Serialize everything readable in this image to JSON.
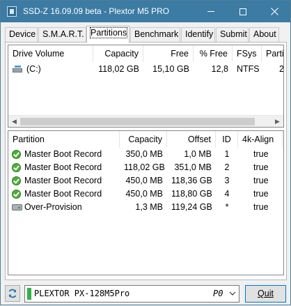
{
  "window": {
    "title": "SSD-Z 16.09.09 beta - Plextor M5 PRO",
    "accent": "#3c7ba3"
  },
  "tabs": [
    {
      "label": "Device"
    },
    {
      "label": "S.M.A.R.T."
    },
    {
      "label": "Partitions",
      "active": true
    },
    {
      "label": "Benchmark"
    },
    {
      "label": "Identify"
    },
    {
      "label": "Submit"
    },
    {
      "label": "About"
    }
  ],
  "volumes": {
    "headers": [
      "Drive Volume",
      "Capacity",
      "Free",
      "% Free",
      "FSys",
      "Partit"
    ],
    "rows": [
      {
        "icon": "drive-icon",
        "name": "(C:)",
        "capacity": "118,02 GB",
        "free": "15,10 GB",
        "pct_free": "12,8",
        "fsys": "NTFS",
        "partition": "2"
      }
    ]
  },
  "partitions": {
    "headers": [
      "Partition",
      "Capacity",
      "Offset",
      "ID",
      "4k-Align"
    ],
    "rows": [
      {
        "icon": "check-icon",
        "name": "Master Boot Record",
        "capacity": "350,0 MB",
        "offset": "1,0 MB",
        "id": "1",
        "align": "true"
      },
      {
        "icon": "check-icon",
        "name": "Master Boot Record",
        "capacity": "118,02 GB",
        "offset": "351,0 MB",
        "id": "2",
        "align": "true"
      },
      {
        "icon": "check-icon",
        "name": "Master Boot Record",
        "capacity": "450,0 MB",
        "offset": "118,36 GB",
        "id": "3",
        "align": "true"
      },
      {
        "icon": "check-icon",
        "name": "Master Boot Record",
        "capacity": "450,0 MB",
        "offset": "118,80 GB",
        "id": "4",
        "align": "true"
      },
      {
        "icon": "disk-icon",
        "name": "Over-Provision",
        "capacity": "1,3 MB",
        "offset": "119,24 GB",
        "id": "*",
        "align": "true"
      }
    ]
  },
  "bottom": {
    "device": "PLEXTOR PX-128M5Pro",
    "port": "P0",
    "quit_label": "Quit"
  }
}
